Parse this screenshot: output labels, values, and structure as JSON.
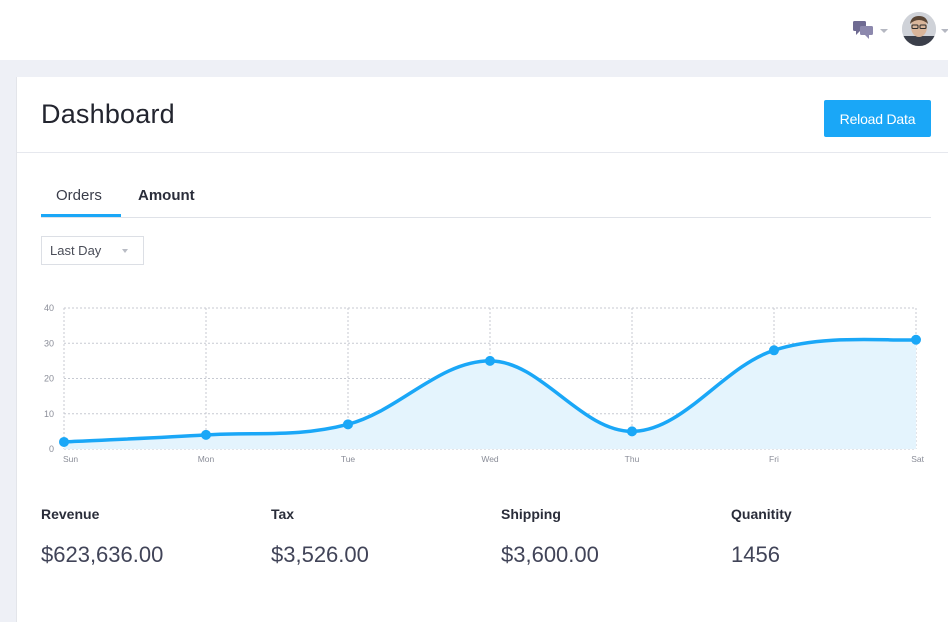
{
  "topbar": {
    "chat_icon": "chat-bubbles-icon",
    "avatar_icon": "user-avatar",
    "chevron_icon": "chevron-down-icon"
  },
  "header": {
    "title": "Dashboard",
    "reload_label": "Reload Data"
  },
  "tabs": [
    {
      "label": "Orders",
      "active": true
    },
    {
      "label": "Amount",
      "active": false
    }
  ],
  "range": {
    "selected": "Last Day"
  },
  "colors": {
    "accent": "#1aa7f7",
    "area_fill": "#e4f4fd",
    "grid": "#c7cad2"
  },
  "chart_data": {
    "type": "area",
    "categories": [
      "Sun",
      "Mon",
      "Tue",
      "Wed",
      "Thu",
      "Fri",
      "Sat"
    ],
    "values": [
      2,
      4,
      7,
      25,
      5,
      28,
      31
    ],
    "ylim": [
      0,
      40
    ],
    "yticks": [
      0,
      10,
      20,
      30,
      40
    ],
    "grid": true,
    "smooth": true
  },
  "stats": [
    {
      "label": "Revenue",
      "value": "$623,636.00"
    },
    {
      "label": "Tax",
      "value": "$3,526.00"
    },
    {
      "label": "Shipping",
      "value": "$3,600.00"
    },
    {
      "label": "Quanitity",
      "value": "1456"
    }
  ]
}
